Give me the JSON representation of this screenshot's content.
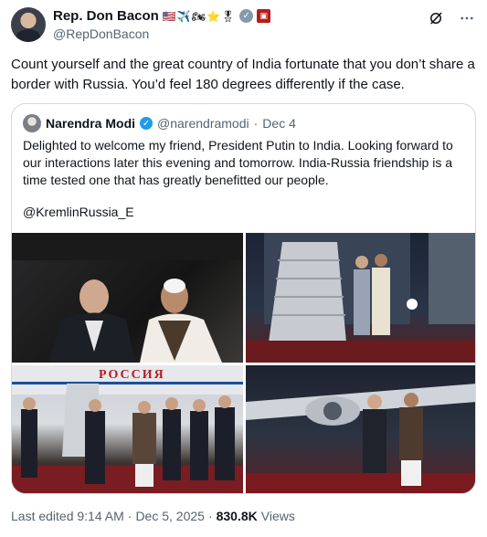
{
  "author": {
    "display_name": "Rep. Don Bacon",
    "name_emoji": "🇺🇸✈️🏍⭐🎖",
    "handle": "@RepDonBacon"
  },
  "tweet": {
    "text": "Count yourself and the great country of India fortunate that you don’t share a border with Russia. You’d feel 180 degrees differently if the case."
  },
  "quote": {
    "display_name": "Narendra Modi",
    "handle": "@narendramodi",
    "separator": "·",
    "date": "Dec 4",
    "text": "Delighted to welcome my friend, President Putin to India. Looking forward to our interactions later this evening and tomorrow. India-Russia friendship is a time tested one that has greatly benefitted our people.",
    "mention": "@KremlinRussia_E",
    "photo3_sign": "РОССИЯ"
  },
  "footer": {
    "edited": "Last edited 9:14 AM",
    "dot1": "·",
    "date": "Dec 5, 2025",
    "dot2": "·",
    "views_count": "830.8K",
    "views_label": "Views"
  }
}
